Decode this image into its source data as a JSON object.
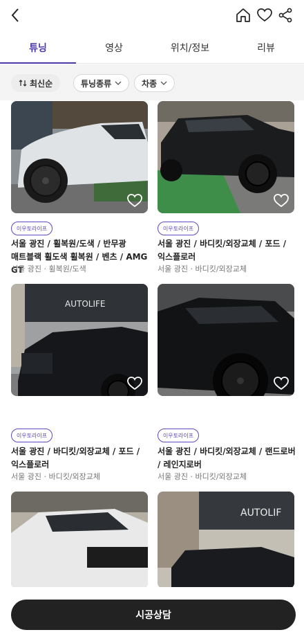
{
  "header": {
    "back_icon": "chevron-left-icon",
    "actions": [
      "home-icon",
      "heart-icon",
      "share-icon"
    ]
  },
  "tabs": [
    {
      "label": "튜닝",
      "active": true
    },
    {
      "label": "영상",
      "active": false
    },
    {
      "label": "위치/정보",
      "active": false
    },
    {
      "label": "리뷰",
      "active": false
    }
  ],
  "filters": {
    "sort": "최신순",
    "tuning_type": "튜닝종류",
    "car_type": "차종"
  },
  "cards": [
    {
      "badge": "이우토라이프",
      "title": "서울 광진 / 휠복원/도색 / 반무광 매트블랙 휠도색 휠복원 / 벤츠 / AMG GT",
      "meta": "서울 광진 · 휠복원/도색"
    },
    {
      "badge": "이우토라이프",
      "title": "서울 광진 / 바디킷/외장교체 / 포드 / 익스플로러",
      "meta": "서울 광진 · 바디킷/외장교체"
    },
    {
      "badge": "이우토라이프",
      "title": "서울 광진 / 바디킷/외장교체 / 포드 / 익스플로러",
      "meta": "서울 광진 · 바디킷/외장교체"
    },
    {
      "badge": "이우토라이프",
      "title": "서울 광진 / 바디킷/외장교체 / 랜드로버 / 레인지로버",
      "meta": "서울 광진 · 바디킷/외장교체"
    }
  ],
  "image_signs": {
    "autolife": "AUTOLIFE",
    "autolif": "AUTOLIF"
  },
  "cta": {
    "label": "시공상담"
  },
  "colors": {
    "accent": "#4a3aa8",
    "cta_bg": "#222222"
  }
}
